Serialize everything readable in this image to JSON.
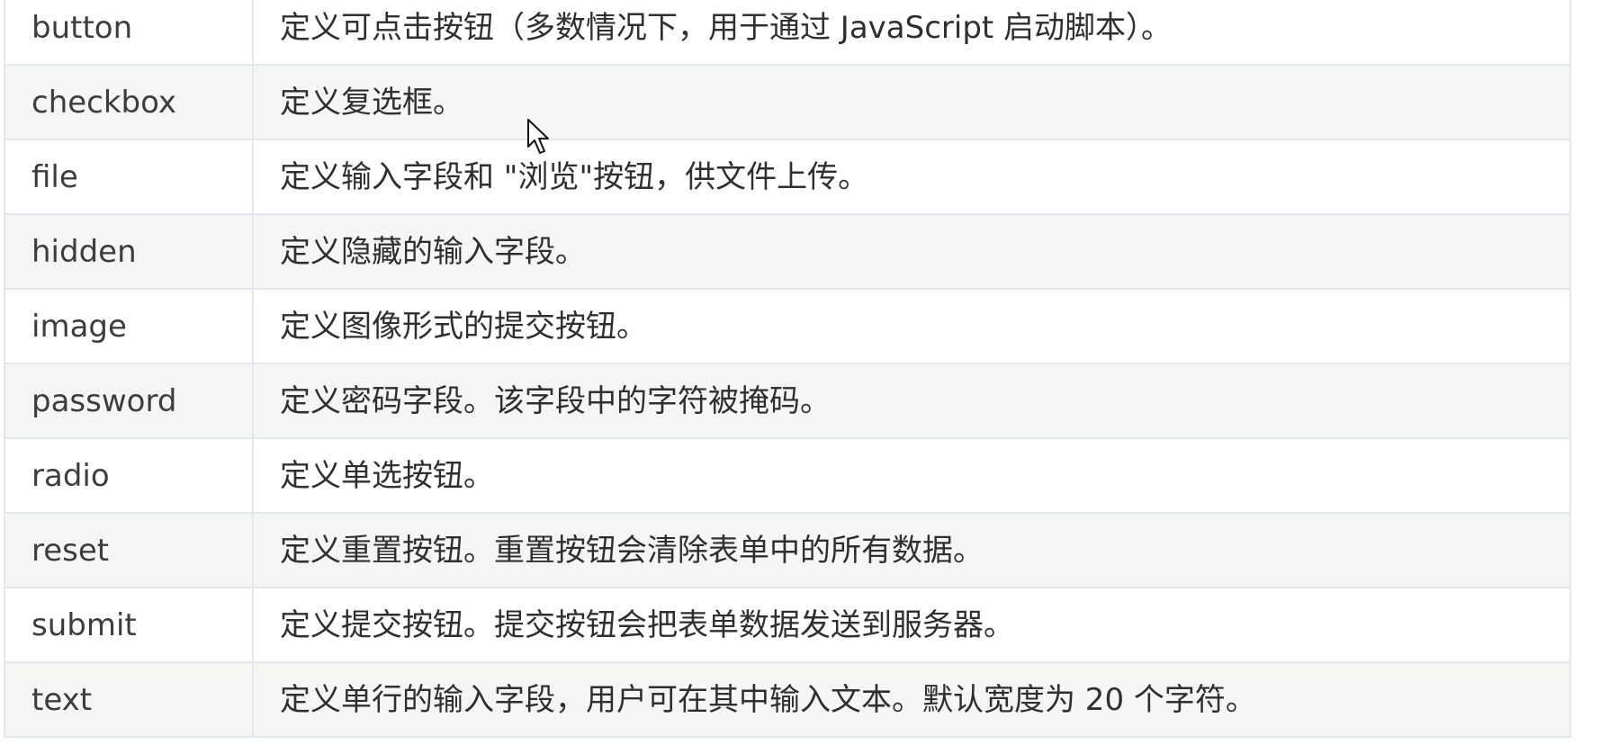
{
  "table": {
    "rows": [
      {
        "value": "button",
        "description": "定义可点击按钮（多数情况下，用于通过 JavaScript 启动脚本）。"
      },
      {
        "value": "checkbox",
        "description": "定义复选框。"
      },
      {
        "value": "file",
        "description": "定义输入字段和 \"浏览\"按钮，供文件上传。"
      },
      {
        "value": "hidden",
        "description": "定义隐藏的输入字段。"
      },
      {
        "value": "image",
        "description": "定义图像形式的提交按钮。"
      },
      {
        "value": "password",
        "description": "定义密码字段。该字段中的字符被掩码。"
      },
      {
        "value": "radio",
        "description": "定义单选按钮。"
      },
      {
        "value": "reset",
        "description": "定义重置按钮。重置按钮会清除表单中的所有数据。"
      },
      {
        "value": "submit",
        "description": "定义提交按钮。提交按钮会把表单数据发送到服务器。"
      },
      {
        "value": "text",
        "description": "定义单行的输入字段，用户可在其中输入文本。默认宽度为 20 个字符。"
      }
    ]
  },
  "cursor": {
    "icon": "mouse-pointer-icon"
  }
}
